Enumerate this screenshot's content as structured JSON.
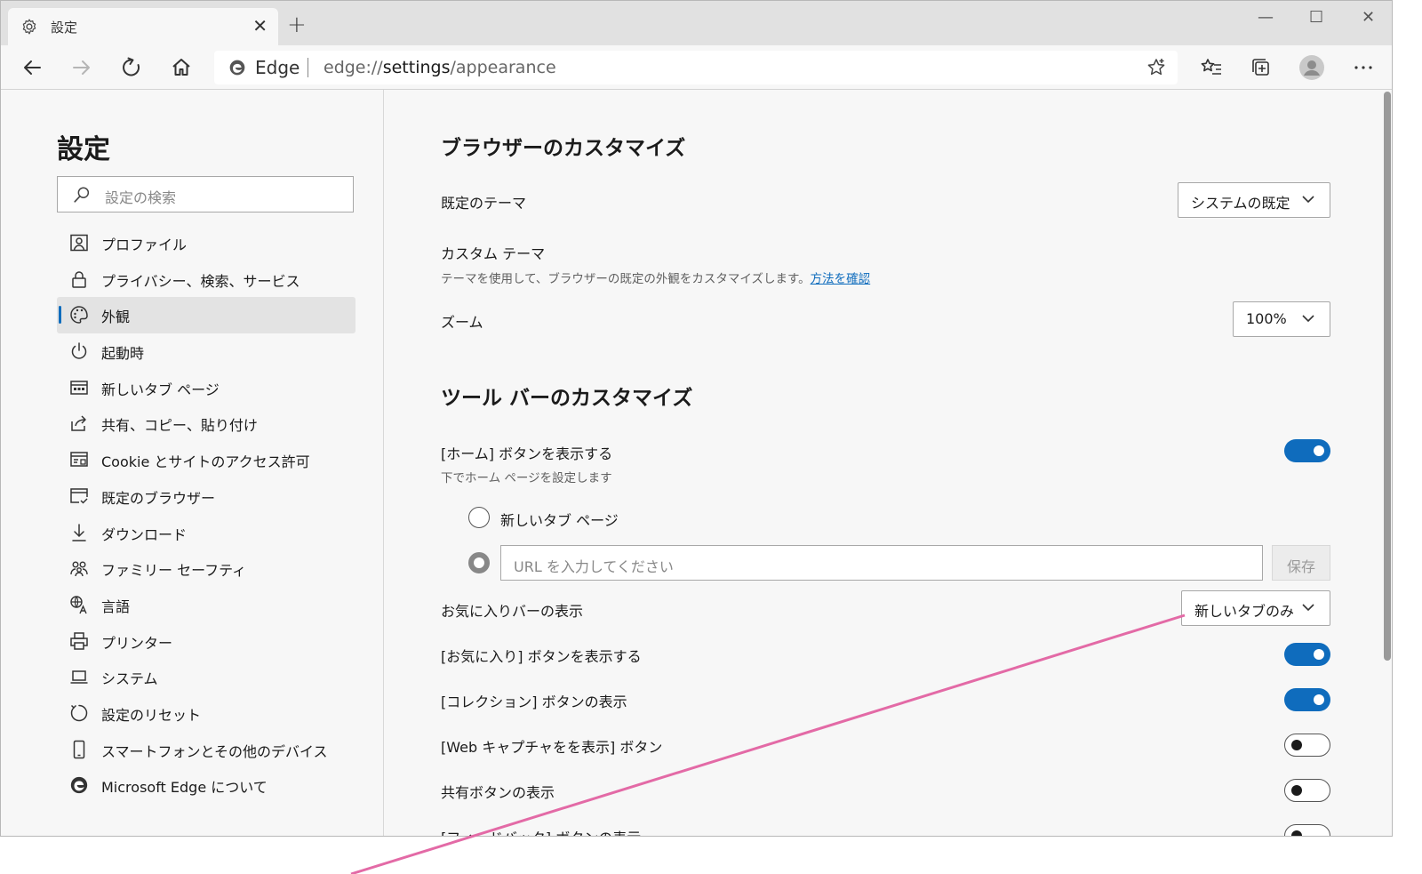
{
  "tab": {
    "title": "設定",
    "settings_icon": "gear-icon",
    "close_glyph": "✕",
    "new_tab_glyph": "+"
  },
  "window_controls": {
    "minimize": "—",
    "maximize": "☐",
    "close": "✕"
  },
  "address_bar": {
    "brand": "Edge",
    "url_scheme": "edge://",
    "url_host": "settings",
    "url_path": "/appearance"
  },
  "sidebar": {
    "title": "設定",
    "search_placeholder": "設定の検索",
    "items": [
      {
        "label": "プロファイル",
        "icon": "profile-icon"
      },
      {
        "label": "プライバシー、検索、サービス",
        "icon": "lock-icon"
      },
      {
        "label": "外観",
        "icon": "palette-icon",
        "active": true
      },
      {
        "label": "起動時",
        "icon": "power-icon"
      },
      {
        "label": "新しいタブ ページ",
        "icon": "newtab-page-icon"
      },
      {
        "label": "共有、コピー、貼り付け",
        "icon": "share-icon"
      },
      {
        "label": "Cookie とサイトのアクセス許可",
        "icon": "site-permissions-icon"
      },
      {
        "label": "既定のブラウザー",
        "icon": "default-browser-icon"
      },
      {
        "label": "ダウンロード",
        "icon": "download-icon"
      },
      {
        "label": "ファミリー セーフティ",
        "icon": "family-icon"
      },
      {
        "label": "言語",
        "icon": "language-icon"
      },
      {
        "label": "プリンター",
        "icon": "printer-icon"
      },
      {
        "label": "システム",
        "icon": "laptop-icon"
      },
      {
        "label": "設定のリセット",
        "icon": "reset-icon"
      },
      {
        "label": "スマートフォンとその他のデバイス",
        "icon": "phone-icon"
      },
      {
        "label": "Microsoft Edge について",
        "icon": "edge-logo-icon"
      }
    ]
  },
  "main": {
    "browser_section": {
      "title": "ブラウザーのカスタマイズ",
      "default_theme_label": "既定のテーマ",
      "default_theme_value": "システムの既定",
      "custom_theme_label": "カスタム テーマ",
      "custom_theme_desc": "テーマを使用して、ブラウザーの既定の外観をカスタマイズします。",
      "custom_theme_link": "方法を確認",
      "zoom_label": "ズーム",
      "zoom_value": "100%"
    },
    "toolbar_section": {
      "title": "ツール バーのカスタマイズ",
      "home_label": "[ホーム] ボタンを表示する",
      "home_desc": "下でホーム ページを設定します",
      "home_on": true,
      "radio_newtab_label": "新しいタブ ページ",
      "url_placeholder": "URL を入力してください",
      "save_label": "保存",
      "favbar_label": "お気に入りバーの表示",
      "favbar_value": "新しいタブのみ",
      "fav_button_label": "[お気に入り] ボタンを表示する",
      "fav_button_on": true,
      "collections_label": "[コレクション] ボタンの表示",
      "collections_on": true,
      "webcapture_label": "[Web キャプチャをを表示] ボタン",
      "webcapture_on": false,
      "share_label": "共有ボタンの表示",
      "share_on": false,
      "feedback_label": "[フィードバック] ボタンの表示",
      "feedback_on": false
    }
  },
  "colors": {
    "accent": "#0f6cbd",
    "annotation_line": "#e36aa6"
  }
}
